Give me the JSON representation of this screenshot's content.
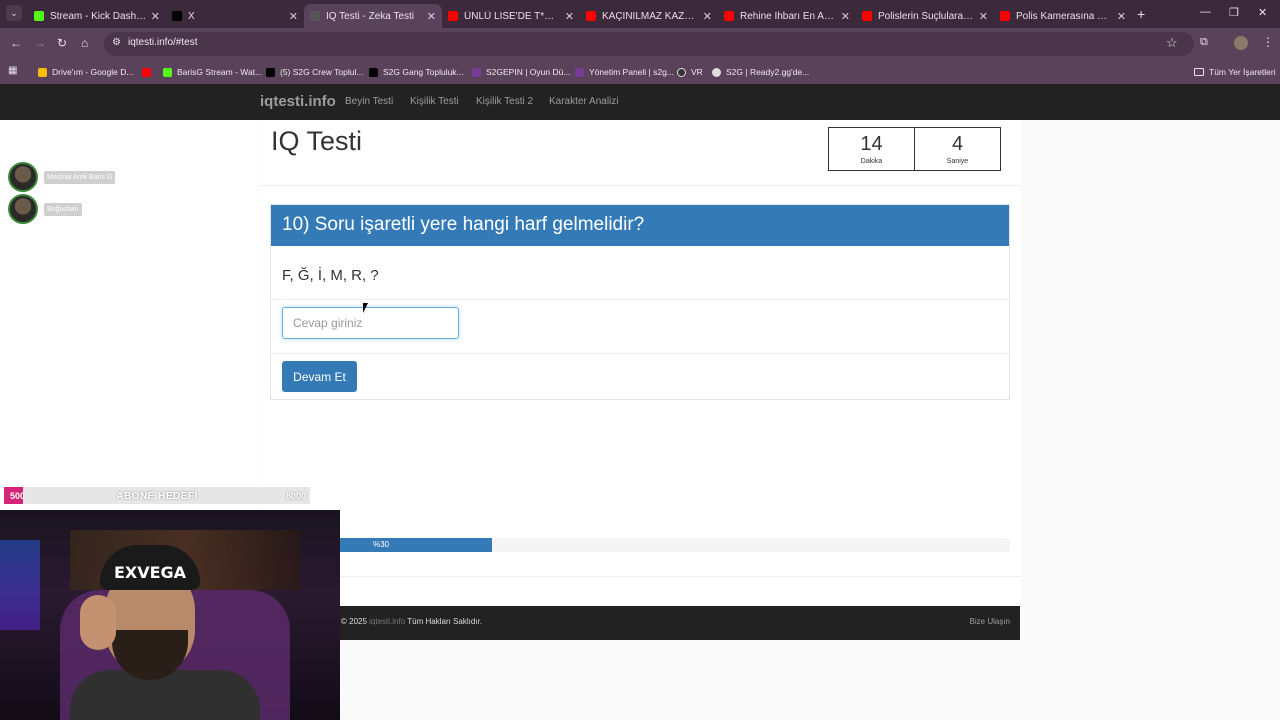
{
  "browser": {
    "tabs": [
      {
        "title": "Stream - Kick Dashboard",
        "favicon_color": "#53fc18",
        "active": false
      },
      {
        "title": "X",
        "favicon_color": "#000000",
        "active": false
      },
      {
        "title": "IQ Testi - Zeka Testi",
        "favicon_color": "#555555",
        "active": true
      },
      {
        "title": "ÜNLÜ LİSE'DE T*CİZ İDDİ...",
        "favicon_color": "#ff0000",
        "active": false
      },
      {
        "title": "KAÇINILMAZ KAZA! Türki...",
        "favicon_color": "#ff0000",
        "active": false
      },
      {
        "title": "Rehine İhbarı En Acı Polis...",
        "favicon_color": "#ff0000",
        "active": false
      },
      {
        "title": "Polislerin Suçlulara Karşı...",
        "favicon_color": "#ff0000",
        "active": false
      },
      {
        "title": "Polis Kamerasına Yakalan...",
        "favicon_color": "#ff0000",
        "active": false
      }
    ],
    "url": "iqtesti.info/#test",
    "bookmarks": [
      {
        "label": "Drive'ım - Google D...",
        "favicon_color": "#fbbc04"
      },
      {
        "label": "",
        "favicon_color": "#ff0000"
      },
      {
        "label": "BarisG Stream - Wat...",
        "favicon_color": "#53fc18"
      },
      {
        "label": "(5) S2G Crew Toplul...",
        "favicon_color": "#000000"
      },
      {
        "label": "S2G Gang Topluluk...",
        "favicon_color": "#000000"
      },
      {
        "label": "S2GEPIN | Oyun Dü...",
        "favicon_color": "#7a3a9a"
      },
      {
        "label": "Yönetim Paneli | s2g...",
        "favicon_color": "#7a3a9a"
      },
      {
        "label": "VR",
        "favicon_color": "#333333"
      },
      {
        "label": "S2G | Ready2.gg'de...",
        "favicon_color": "#dddddd"
      }
    ],
    "all_bookmarks": "Tüm Yer İşaretleri"
  },
  "site": {
    "brand": "iqtesti.info",
    "nav": [
      "Beyin Testi",
      "Kişilik Testi",
      "Kişilik Testi 2",
      "Karakter Analizi"
    ],
    "page_title": "IQ Testi",
    "timer": {
      "minutes": "14",
      "minutes_label": "Dakika",
      "seconds": "4",
      "seconds_label": "Saniye"
    },
    "question": "10) Soru işaretli yere hangi harf gelmelidir?",
    "sequence": "F, Ğ, İ, M, R, ?",
    "answer_placeholder": "Cevap giriniz",
    "submit_label": "Devam Et",
    "progress_label": "%30",
    "progress_fraction": 0.3,
    "footer": {
      "prefix": "© 2025",
      "site": "iqtesti.info",
      "rights": "Tüm Hakları Saklıdır.",
      "contact": "Bize Ulaşın"
    }
  },
  "overlay": {
    "viewers": [
      "Marjinal Amk Baris G",
      "Boğachan"
    ],
    "sub_goal": {
      "title": "ABONE HEDEFİ",
      "current": "500",
      "target": "8000",
      "fraction": 0.0625
    },
    "webcam_beanie_text": "EXVEGA"
  },
  "colors": {
    "primary": "#337ab7",
    "navbar": "#222222",
    "goal_fill": "#d4247a"
  }
}
